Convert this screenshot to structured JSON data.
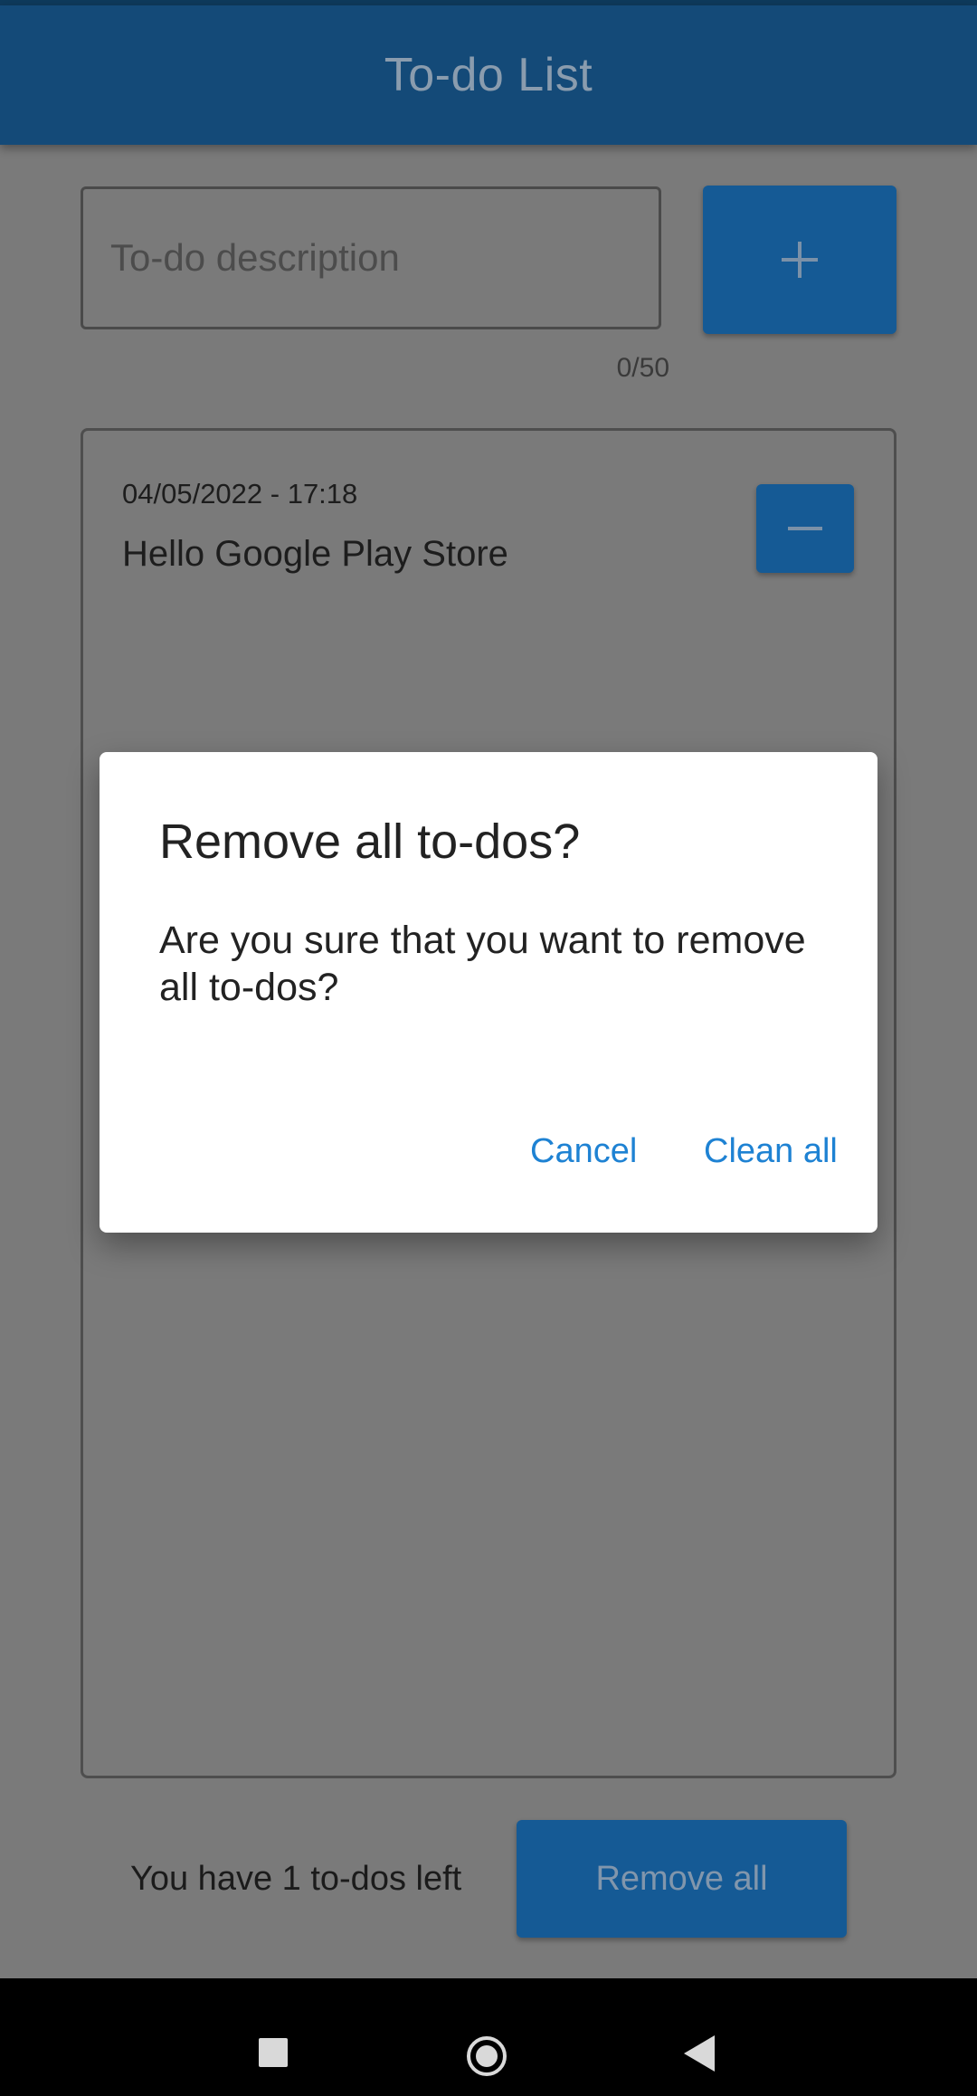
{
  "app_bar": {
    "title": "To-do List"
  },
  "input": {
    "placeholder": "To-do description",
    "value": "",
    "counter": "0/50"
  },
  "todos": [
    {
      "date": "04/05/2022 - 17:18",
      "text": "Hello Google Play Store"
    }
  ],
  "footer": {
    "remaining_text": "You have 1 to-dos left",
    "remove_all_label": "Remove all"
  },
  "dialog": {
    "title": "Remove all to-dos?",
    "message": "Are you sure that you want to remove all to-dos?",
    "cancel_label": "Cancel",
    "confirm_label": "Clean all"
  },
  "icons": {
    "add": "plus-icon",
    "remove": "minus-icon",
    "nav_recents": "square-icon",
    "nav_home": "circle-icon",
    "nav_back": "triangle-back-icon"
  },
  "colors": {
    "primary": "#1565C0",
    "dialog_action": "#1E82D3",
    "scrim": "#7A7A7A"
  }
}
